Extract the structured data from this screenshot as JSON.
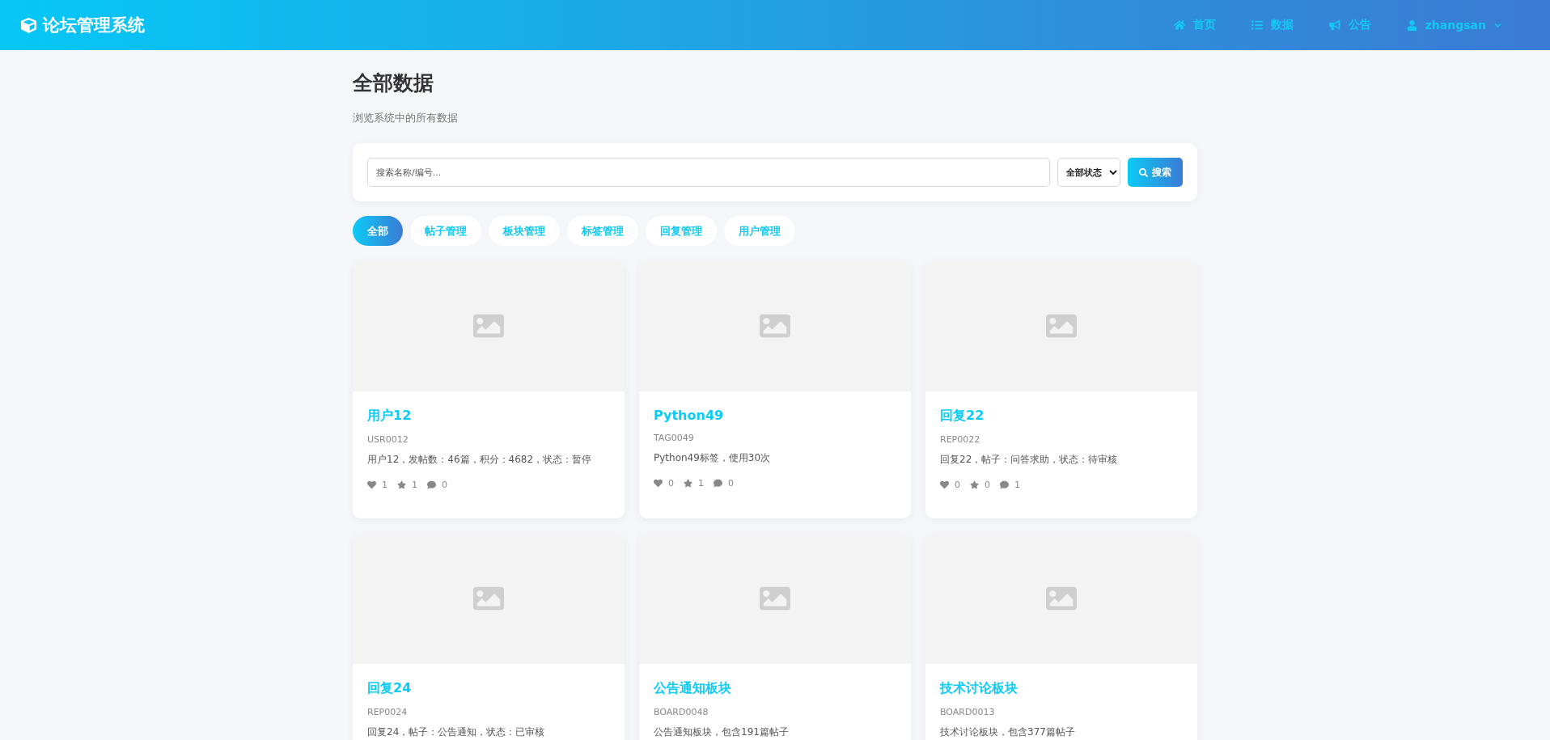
{
  "header": {
    "brand": "论坛管理系统",
    "nav": [
      {
        "kind": "home",
        "label": "首页"
      },
      {
        "kind": "list",
        "label": "数据"
      },
      {
        "kind": "announce",
        "label": "公告"
      },
      {
        "kind": "user",
        "label": "zhangsan",
        "dropdown": true
      }
    ]
  },
  "page": {
    "title": "全部数据",
    "subtitle": "浏览系统中的所有数据"
  },
  "search": {
    "placeholder": "搜索名称/编号...",
    "status_select": "全部状态",
    "button": "搜索"
  },
  "tabs": [
    {
      "label": "全部",
      "selected": true
    },
    {
      "label": "帖子管理",
      "selected": false
    },
    {
      "label": "板块管理",
      "selected": false
    },
    {
      "label": "标签管理",
      "selected": false
    },
    {
      "label": "回复管理",
      "selected": false
    },
    {
      "label": "用户管理",
      "selected": false
    }
  ],
  "cards": [
    {
      "title": "用户12",
      "code": "USR0012",
      "description": "用户12，发帖数：46篇，积分：4682，状态：暂停",
      "stats": [
        {
          "kind": "likes",
          "count": "1"
        },
        {
          "kind": "favorites",
          "count": "1"
        },
        {
          "kind": "comments",
          "count": "0"
        }
      ]
    },
    {
      "title": "Python49",
      "code": "TAG0049",
      "description": "Python49标签，使用30次",
      "stats": [
        {
          "kind": "likes",
          "count": "0"
        },
        {
          "kind": "favorites",
          "count": "1"
        },
        {
          "kind": "comments",
          "count": "0"
        }
      ]
    },
    {
      "title": "回复22",
      "code": "REP0022",
      "description": "回复22，帖子：问答求助，状态：待审核",
      "stats": [
        {
          "kind": "likes",
          "count": "0"
        },
        {
          "kind": "favorites",
          "count": "0"
        },
        {
          "kind": "comments",
          "count": "1"
        }
      ]
    },
    {
      "title": "回复24",
      "code": "REP0024",
      "description": "回复24，帖子：公告通知，状态：已审核"
    },
    {
      "title": "公告通知板块",
      "code": "BOARD0048",
      "description": "公告通知板块，包含191篇帖子"
    },
    {
      "title": "技术讨论板块",
      "code": "BOARD0013",
      "description": "技术讨论板块，包含377篇帖子"
    }
  ]
}
